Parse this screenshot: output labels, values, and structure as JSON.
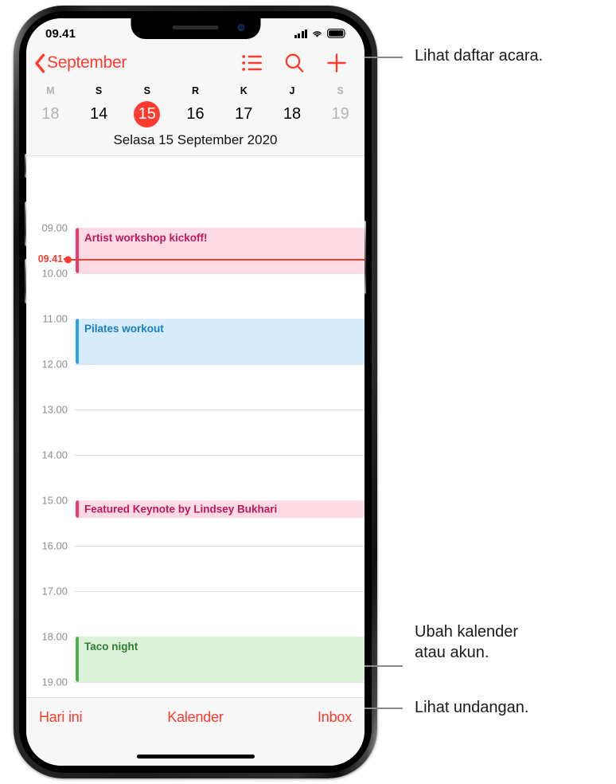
{
  "status_bar": {
    "time": "09.41",
    "cellular_icon": "signal-bars-icon",
    "wifi_icon": "wifi-icon",
    "battery_icon": "battery-icon"
  },
  "nav_bar": {
    "back_label": "September",
    "back_icon": "chevron-left-icon",
    "actions": [
      {
        "name": "list-view-button",
        "icon": "bulleted-list-icon"
      },
      {
        "name": "search-button",
        "icon": "magnifying-glass-icon"
      },
      {
        "name": "add-event-button",
        "icon": "plus-icon"
      }
    ]
  },
  "week_strip": {
    "weekday_initials": [
      "M",
      "S",
      "S",
      "R",
      "K",
      "J",
      "S"
    ],
    "weekday_dim": [
      true,
      false,
      false,
      false,
      false,
      false,
      true
    ],
    "days": [
      "18",
      "14",
      "15",
      "16",
      "17",
      "18",
      "19"
    ],
    "day_dim": [
      true,
      false,
      false,
      false,
      false,
      false,
      true
    ],
    "selected_index": 2,
    "day_title": "Selasa  15 September 2020"
  },
  "timeline": {
    "hours": [
      "09.00",
      "10.00",
      "11.00",
      "12.00",
      "13.00",
      "14.00",
      "15.00",
      "16.00",
      "17.00",
      "18.00",
      "19.00"
    ],
    "current_time_label": "09.41",
    "current_time_color": "#ff3b30",
    "events": [
      {
        "title": "Artist workshop kickoff!",
        "start": "09.00",
        "end": "10.00",
        "bg": "#fcdbe5",
        "bar": "#f4386c",
        "text": "#c2185b"
      },
      {
        "title": "Pilates workout",
        "start": "11.00",
        "end": "12.00",
        "bg": "#d6ecfa",
        "bar": "#2aa3ef",
        "text": "#1a7fc1"
      },
      {
        "title": "Featured Keynote by Lindsey Bukhari",
        "start": "14.60",
        "end": "15.00",
        "bg": "#fcdbe5",
        "bar": "#f4386c",
        "text": "#c2185b"
      },
      {
        "title": "Taco night",
        "start": "18.00",
        "end": "19.00",
        "bg": "#dcf2d8",
        "bar": "#4caf50",
        "text": "#2e7d32"
      }
    ]
  },
  "tab_bar": {
    "items": [
      {
        "name": "tab-today",
        "label": "Hari ini"
      },
      {
        "name": "tab-calendars",
        "label": "Kalender"
      },
      {
        "name": "tab-inbox",
        "label": "Inbox"
      }
    ]
  },
  "callouts": [
    {
      "name": "callout-list-view",
      "text": "Lihat daftar acara."
    },
    {
      "name": "callout-calendars",
      "text": "Ubah kalender\natau akun."
    },
    {
      "name": "callout-inbox",
      "text": "Lihat undangan."
    }
  ]
}
